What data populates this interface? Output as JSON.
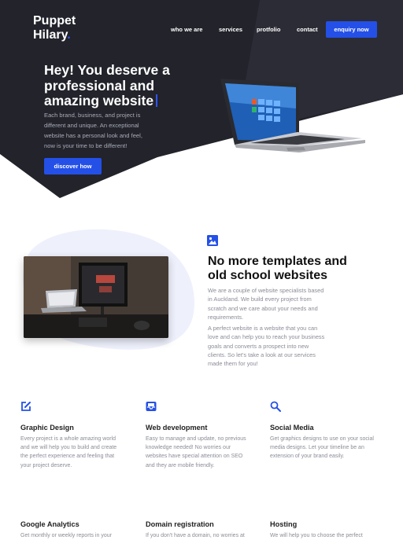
{
  "brand": {
    "name_line1": "Puppet",
    "name_line2": "Hilary",
    "dot": ".",
    "accent": "#2450e8",
    "dark_bg": "#22232b"
  },
  "nav": {
    "items": [
      "who we are",
      "services",
      "protfolio",
      "contact"
    ],
    "cta": "enquiry now"
  },
  "hero": {
    "title_line1": "Hey! You deserve a",
    "title_line2": "professional and",
    "title_line3": "amazing website",
    "text_line1": "Each brand, business, and project is",
    "text_line2": "different and unique. An exceptional",
    "text_line3": "website has a personal look and feel,",
    "text_line4": "now is your time to be different!",
    "button": "discover how",
    "image_icon": "laptop-image"
  },
  "about": {
    "icon": "picture-icon",
    "title_line1": "No more templates and",
    "title_line2": "old school websites",
    "p1_lines": [
      "We are a couple of website specialists based",
      "in Auckland. We build every project from",
      "scratch and we care about your needs and",
      "requirements."
    ],
    "p2_lines": [
      "A perfect website is a website that you can",
      "love and can help you to reach your business",
      "goals and converts a prospect into new",
      "clients. So let's take a look at our services",
      "made them for you!"
    ]
  },
  "services": [
    {
      "icon": "edit-icon",
      "title": "Graphic Design",
      "lines": [
        "Every project is a whole amazing world",
        "and we will help you to build and create",
        "the perfect experience and feeling that",
        "your project deserve."
      ]
    },
    {
      "icon": "inbox-icon",
      "title": "Web development",
      "lines": [
        "Easy to manage and update, no previous",
        "knowledge needed! No worries our",
        "websites have special attention on SEO",
        "and they are mobile friendly."
      ]
    },
    {
      "icon": "search-icon",
      "title": "Social Media",
      "lines": [
        "Get graphics designs to use on your social",
        "media designs. Let your timeline be an",
        "extension of your brand easily."
      ]
    },
    {
      "title": "Google Analytics",
      "lines": [
        "Get monthly or weekly reports in your"
      ]
    },
    {
      "title": "Domain registration",
      "lines": [
        "If you don't have a domain, no worries at"
      ]
    },
    {
      "title": "Hosting",
      "lines": [
        "We will help you to choose the perfect"
      ]
    }
  ]
}
